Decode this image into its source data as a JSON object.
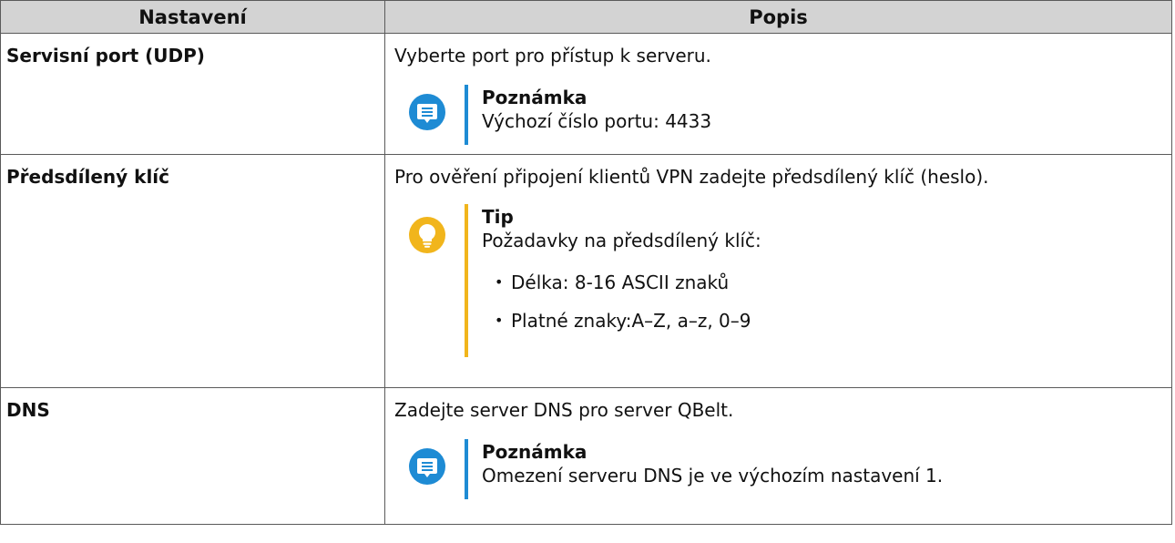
{
  "header": {
    "col_setting": "Nastavení",
    "col_description": "Popis"
  },
  "rows": [
    {
      "setting": "Servisní port (UDP)",
      "description": "Vyberte port pro přístup k serveru.",
      "callout": {
        "type": "note",
        "icon": "note-icon",
        "title": "Poznámka",
        "text": "Výchozí číslo portu: 4433"
      }
    },
    {
      "setting": "Předsdílený klíč",
      "description": "Pro ověření připojení klientů VPN zadejte předsdílený klíč (heslo).",
      "callout": {
        "type": "tip",
        "icon": "lightbulb-icon",
        "title": "Tip",
        "text": "Požadavky na předsdílený klíč:",
        "items": [
          "Délka: 8-16 ASCII znaků",
          "Platné znaky:A–Z, a–z, 0–9"
        ]
      }
    },
    {
      "setting": "DNS",
      "description": "Zadejte server DNS pro server QBelt.",
      "callout": {
        "type": "note",
        "icon": "note-icon",
        "title": "Poznámka",
        "text": "Omezení serveru DNS je ve výchozím nastavení 1."
      }
    }
  ],
  "bullet_glyph": "•",
  "colors": {
    "header_bg": "#d3d3d3",
    "note_blue": "#1e8bd4",
    "tip_yellow": "#f1b51c"
  }
}
